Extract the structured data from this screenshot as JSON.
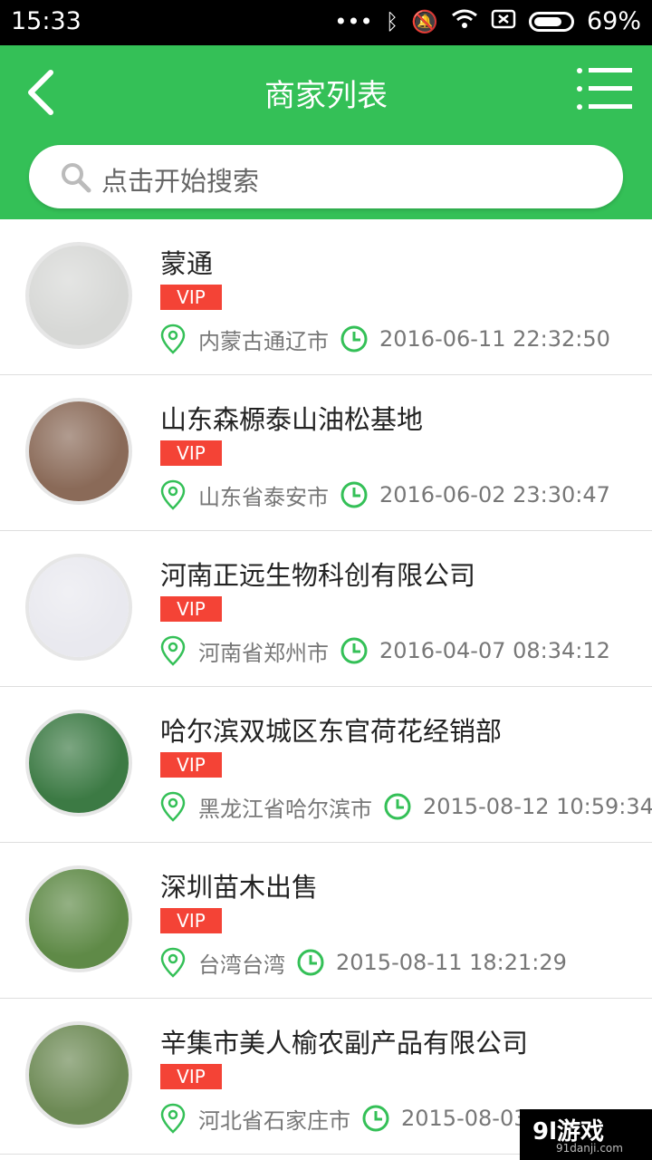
{
  "status_bar": {
    "time": "15:33",
    "battery": "69%"
  },
  "header": {
    "title": "商家列表",
    "search_placeholder": "点击开始搜索"
  },
  "merchants": [
    {
      "name": "蒙通",
      "badge": "VIP",
      "location": "内蒙古通辽市",
      "time": "2016-06-11 22:32:50",
      "avatar_color": "#d7d8d6"
    },
    {
      "name": "山东森榞泰山油松基地",
      "badge": "VIP",
      "location": "山东省泰安市",
      "time": "2016-06-02 23:30:47",
      "avatar_color": "#8a6a58"
    },
    {
      "name": "河南正远生物科创有限公司",
      "badge": "VIP",
      "location": "河南省郑州市",
      "time": "2016-04-07 08:34:12",
      "avatar_color": "#e9e9ef"
    },
    {
      "name": "哈尔滨双城区东官荷花经销部",
      "badge": "VIP",
      "location": "黑龙江省哈尔滨市",
      "time": "2015-08-12 10:59:34",
      "avatar_color": "#3c7a44"
    },
    {
      "name": "深圳苗木出售",
      "badge": "VIP",
      "location": "台湾台湾",
      "time": "2015-08-11 18:21:29",
      "avatar_color": "#5f8a47"
    },
    {
      "name": "辛集市美人榆农副产品有限公司",
      "badge": "VIP",
      "location": "河北省石家庄市",
      "time": "2015-08-03 1",
      "avatar_color": "#6d8a55"
    }
  ],
  "colors": {
    "accent": "#34c057",
    "vip": "#f44336"
  },
  "watermark": {
    "brand": "9l游戏",
    "site": "91danji.com"
  }
}
